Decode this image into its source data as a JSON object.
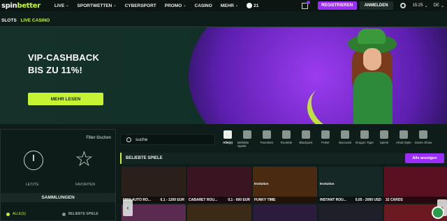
{
  "logo": {
    "part1": "spin",
    "part2": "better"
  },
  "nav": {
    "items": [
      {
        "label": "LIVE",
        "chev": "⌄"
      },
      {
        "label": "SPORTWETTEN",
        "chev": "⌄"
      },
      {
        "label": "CYBERSPORT",
        "chev": ""
      },
      {
        "label": "PROMO",
        "chev": "⌄"
      },
      {
        "label": "CASINO",
        "chev": ""
      },
      {
        "label": "MEHR",
        "chev": "⌄"
      }
    ],
    "count": "21"
  },
  "header": {
    "register": "REGISTRIEREN",
    "login": "ANMELDEN",
    "time": "15:25",
    "lang": "DE"
  },
  "subnav": {
    "slots": "SLOTS",
    "live": "LIVE CASINO"
  },
  "banner": {
    "title_line1": "VIP-CASHBACK",
    "title_line2": "BIS ZU 11%!",
    "button": "MEHR LESEN"
  },
  "filter": {
    "clear": "Filter löschen",
    "recent": "LETZTE",
    "favorites": "FAVORITEN",
    "collections": "SAMMLUNGEN",
    "coll_all": "ALLE(S)",
    "coll_popular": "BELIEBTE SPIELE"
  },
  "search": {
    "value": "suche"
  },
  "categories": [
    {
      "label": "Alle(s)"
    },
    {
      "label": "Beliebte Spiele"
    },
    {
      "label": "Favoriten"
    },
    {
      "label": "Roulette"
    },
    {
      "label": "Blackjack"
    },
    {
      "label": "Poker"
    },
    {
      "label": "Baccarat"
    },
    {
      "label": "Dragon Tiger"
    },
    {
      "label": "Spiele"
    },
    {
      "label": "Hindi Style"
    },
    {
      "label": "Game Show"
    }
  ],
  "popular": {
    "title": "BELIEBTE SPIELE",
    "show_all": "Alle anzeigen"
  },
  "games": [
    {
      "name": "500X AUTO RO...",
      "range": "0,1 - 1200 EUR",
      "provider": "",
      "bg": "#2b1f1a"
    },
    {
      "name": "CABARET ROU...",
      "range": "0,1 - 600 EUR",
      "provider": "",
      "bg": "#3a1420"
    },
    {
      "name": "FUNKY TIME",
      "range": "",
      "provider": "Evolution",
      "bg": "#4a2a10"
    },
    {
      "name": "INSTANT ROU...",
      "range": "0,05 - 2000 USD",
      "provider": "Evolution",
      "bg": "#152826"
    },
    {
      "name": "32 CARDS",
      "range": "",
      "provider": "",
      "bg": "#5a1020"
    }
  ],
  "colors": {
    "accent": "#c6f432",
    "purple": "#9b2dff",
    "bg": "#0f1d1a"
  }
}
